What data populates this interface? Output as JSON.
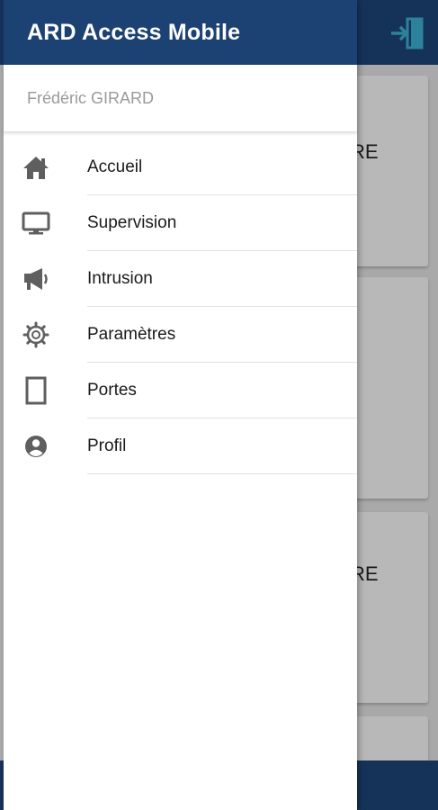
{
  "app": {
    "title": "ARD Access Mobile",
    "colors": {
      "header": "#1c4273",
      "accent": "#3aa7c7"
    }
  },
  "user": {
    "name": "Frédéric GIRARD"
  },
  "menu": {
    "items": [
      {
        "label": "Accueil",
        "icon": "home-icon"
      },
      {
        "label": "Supervision",
        "icon": "monitor-icon"
      },
      {
        "label": "Intrusion",
        "icon": "megaphone-icon"
      },
      {
        "label": "Paramètres",
        "icon": "gear-icon"
      },
      {
        "label": "Portes",
        "icon": "door-icon"
      },
      {
        "label": "Profil",
        "icon": "account-icon"
      }
    ]
  },
  "background": {
    "cards": [
      {
        "label": "RE"
      },
      {
        "label": ""
      },
      {
        "label": "RE"
      }
    ]
  }
}
